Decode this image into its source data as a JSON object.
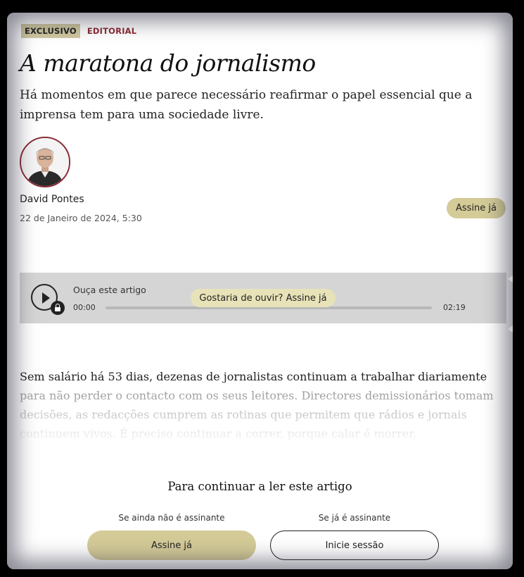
{
  "article": {
    "tag_exclusive": "EXCLUSIVO",
    "tag_section": "EDITORIAL",
    "title": "A maratona do jornalismo",
    "lead": "Há momentos em que parece necessário reafirmar o papel essencial que a imprensa tem para uma sociedade livre.",
    "author": "David Pontes",
    "date": "22 de Janeiro de 2024, 5:30",
    "subscribe_label": "Assine já"
  },
  "audio_player": {
    "label": "Ouça este artigo",
    "time_current": "00:00",
    "time_total": "02:19",
    "progress": 0,
    "prompt_label": "Gostaria de ouvir? Assine já"
  },
  "body": {
    "text": "Sem salário há 53 dias, dezenas de jornalistas continuam a trabalhar diariamente para não perder o contacto com os seus leitores. Directores demissionários tomam decisões, as redacções cumprem as rotinas que permitem que rádios e jornais continuem vivos. É preciso continuar a correr, porque calar é morrer."
  },
  "paywall": {
    "title": "Para continuar a ler este artigo",
    "not_subscriber": "Se ainda não é assinante",
    "subscriber": "Se já é assinante",
    "subscribe_button": "Assine já",
    "login_button": "Inicie sessão"
  },
  "colors": {
    "accent_gold": "#d4cb98",
    "tag_red": "#8a2a33"
  },
  "icons": {
    "play": "play-icon",
    "lock": "lock-icon"
  }
}
